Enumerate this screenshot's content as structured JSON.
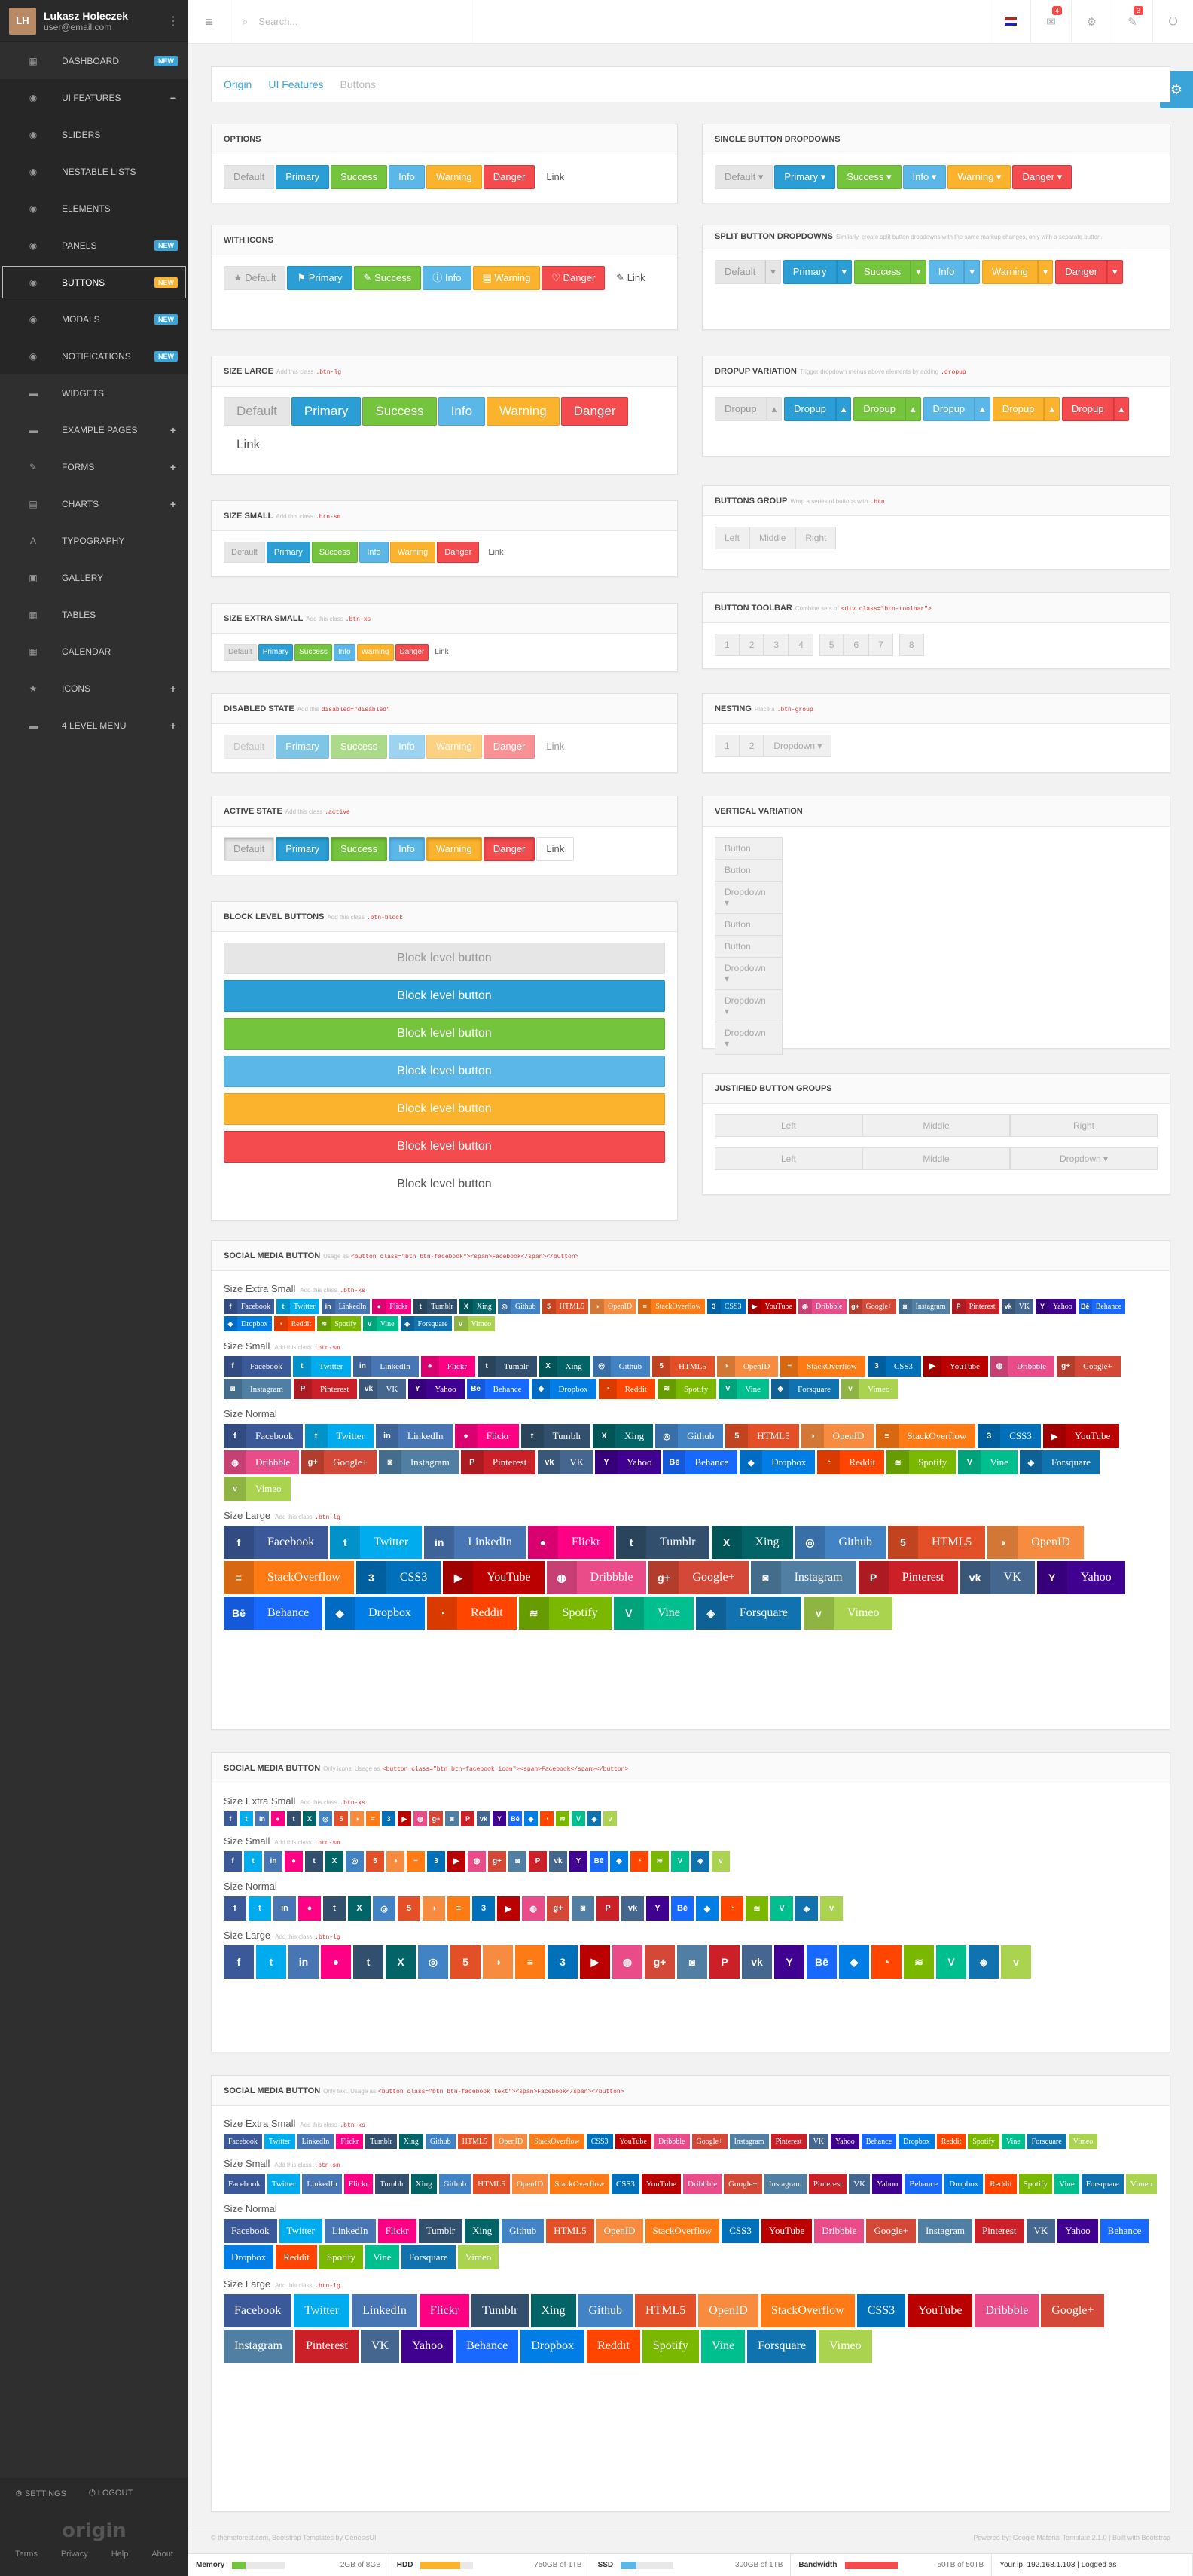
{
  "user": {
    "name": "Lukasz Holeczek",
    "email": "user@email.com",
    "initials": "LH"
  },
  "nav": [
    {
      "label": "Dashboard",
      "icon": "dashboard-icon",
      "glyph": "▦",
      "badge": "NEW",
      "badge_color": "#3aa3d7"
    },
    {
      "label": "UI Features",
      "icon": "eye-icon",
      "glyph": "◉",
      "open": true
    },
    {
      "label": "Sliders",
      "icon": "eye-icon",
      "glyph": "◉",
      "sub": true
    },
    {
      "label": "Nestable Lists",
      "icon": "eye-icon",
      "glyph": "◉",
      "sub": true
    },
    {
      "label": "Elements",
      "icon": "eye-icon",
      "glyph": "◉",
      "sub": true
    },
    {
      "label": "Panels",
      "icon": "eye-icon",
      "glyph": "◉",
      "sub": true,
      "badge": "NEW",
      "badge_color": "#3aa3d7"
    },
    {
      "label": "Buttons",
      "icon": "eye-icon",
      "glyph": "◉",
      "sub": true,
      "active": true,
      "badge": "NEW",
      "badge_color": "#fbb32e"
    },
    {
      "label": "Modals",
      "icon": "eye-icon",
      "glyph": "◉",
      "sub": true,
      "badge": "NEW",
      "badge_color": "#3aa3d7"
    },
    {
      "label": "Notifications",
      "icon": "eye-icon",
      "glyph": "◉",
      "sub": true,
      "badge": "NEW",
      "badge_color": "#3aa3d7"
    },
    {
      "label": "Widgets",
      "icon": "folder-icon",
      "glyph": "▬"
    },
    {
      "label": "Example Pages",
      "icon": "folder-icon",
      "glyph": "▬",
      "plus": true
    },
    {
      "label": "Forms",
      "icon": "edit-icon",
      "glyph": "✎",
      "plus": true
    },
    {
      "label": "Charts",
      "icon": "chart-icon",
      "glyph": "▤",
      "plus": true
    },
    {
      "label": "Typography",
      "icon": "font-icon",
      "glyph": "A"
    },
    {
      "label": "Gallery",
      "icon": "picture-icon",
      "glyph": "▣"
    },
    {
      "label": "Tables",
      "icon": "table-icon",
      "glyph": "▦"
    },
    {
      "label": "Calendar",
      "icon": "calendar-icon",
      "glyph": "▦"
    },
    {
      "label": "Icons",
      "icon": "star-icon",
      "glyph": "★",
      "plus": true
    },
    {
      "label": "4 Level Menu",
      "icon": "folder-icon",
      "glyph": "▬",
      "plus": true
    }
  ],
  "sidebar_bottom": {
    "settings": "Settings",
    "logout": "Logout",
    "logo": "origin",
    "links": [
      "Terms",
      "Privacy",
      "Help",
      "About"
    ]
  },
  "topbar": {
    "search_placeholder": "Search...",
    "notif_count": "4",
    "tools_count": "3"
  },
  "breadcrumb": [
    "Origin",
    "UI Features",
    "Buttons"
  ],
  "labels": {
    "default": "Default",
    "primary": "Primary",
    "success": "Success",
    "info": "Info",
    "warning": "Warning",
    "danger": "Danger",
    "link": "Link",
    "dropup": "Dropup",
    "block": "Block level button",
    "button": "Button",
    "dropdown": "Dropdown",
    "left": "Left",
    "middle": "Middle",
    "right": "Right"
  },
  "panels": {
    "options": "Options",
    "with_icons": "With Icons",
    "size_large": "Size Large",
    "size_small": "Size Small",
    "size_xs": "Size Extra Small",
    "disabled": "Disabled State",
    "active": "Active State",
    "block": "Block Level Buttons",
    "single_dd": "Single Button Dropdowns",
    "split_dd": "Split Button Dropdowns",
    "dropup": "Dropup Variation",
    "btn_group": "Buttons Group",
    "toolbar": "Button Toolbar",
    "nesting": "Nesting",
    "vertical": "Vertical Variation",
    "justified": "Justified Button Groups",
    "social": "Social Media Button"
  },
  "hints": {
    "size_large": "Add this class",
    "size_small": "Add this class",
    "size_xs": "Add this class",
    "disabled": "Add this",
    "active": "Add this class",
    "block": "Add this class",
    "split_dd": "Similarly, create split button dropdowns with the same markup changes, only with a separate button.",
    "dropup": "Trigger dropdown menus above elements by adding",
    "btn_group": "Wrap a series of buttons with",
    "toolbar": "Combine sets of",
    "nesting": "Place a",
    "social_1": "Usage as",
    "social_2": "Only icons. Usage as",
    "social_3": "Only text. Usage as",
    "add_class": "Add this class"
  },
  "codes": {
    "lg": ".btn-lg",
    "sm": ".btn-sm",
    "xs": ".btn-xs",
    "disabled": "disabled=\"disabled\"",
    "active": ".active",
    "block": ".btn-block",
    "dropup": ".dropup",
    "group": ".btn",
    "toolbar": "<div class=\"btn-toolbar\">",
    "nest": ".btn-group",
    "social_1": "<button class=\"btn btn-facebook\"><span>Facebook</span></button>",
    "social_2": "<button class=\"btn btn-facebook icon\"><span>Facebook</span></button>",
    "social_3": "<button class=\"btn btn-facebook text\"><span>Facebook</span></button>"
  },
  "toolbar_numbers": [
    "1",
    "2",
    "3",
    "4",
    "5",
    "6",
    "7",
    "8"
  ],
  "nesting_numbers": [
    "1",
    "2"
  ],
  "social_sizes": [
    "Size Extra Small",
    "Size Small",
    "Size Normal",
    "Size Large"
  ],
  "social_size_codes": [
    ".btn-xs",
    ".btn-sm",
    "",
    ".btn-lg"
  ],
  "social": [
    {
      "name": "Facebook",
      "color": "#3b5998",
      "glyph": "f"
    },
    {
      "name": "Twitter",
      "color": "#00aced",
      "glyph": "t"
    },
    {
      "name": "LinkedIn",
      "color": "#4875b4",
      "glyph": "in"
    },
    {
      "name": "Flickr",
      "color": "#ff0084",
      "glyph": "●"
    },
    {
      "name": "Tumblr",
      "color": "#32506d",
      "glyph": "t"
    },
    {
      "name": "Xing",
      "color": "#026466",
      "glyph": "X"
    },
    {
      "name": "Github",
      "color": "#4183c4",
      "glyph": "◎"
    },
    {
      "name": "HTML5",
      "color": "#e34f26",
      "glyph": "5"
    },
    {
      "name": "OpenID",
      "color": "#f78c40",
      "glyph": "◑"
    },
    {
      "name": "StackOverflow",
      "color": "#fe7a15",
      "glyph": "≡"
    },
    {
      "name": "CSS3",
      "color": "#0170ba",
      "glyph": "3"
    },
    {
      "name": "YouTube",
      "color": "#b00",
      "glyph": "▶"
    },
    {
      "name": "Dribbble",
      "color": "#ea4c89",
      "glyph": "◍"
    },
    {
      "name": "Google+",
      "color": "#d34836",
      "glyph": "g+"
    },
    {
      "name": "Instagram",
      "color": "#517fa4",
      "glyph": "◙"
    },
    {
      "name": "Pinterest",
      "color": "#cb2027",
      "glyph": "P"
    },
    {
      "name": "VK",
      "color": "#45668e",
      "glyph": "vk"
    },
    {
      "name": "Yahoo",
      "color": "#400191",
      "glyph": "Y"
    },
    {
      "name": "Behance",
      "color": "#1769ff",
      "glyph": "Bē"
    },
    {
      "name": "Dropbox",
      "color": "#007ee5",
      "glyph": "◆"
    },
    {
      "name": "Reddit",
      "color": "#ff4500",
      "glyph": "◔"
    },
    {
      "name": "Spotify",
      "color": "#7ab800",
      "glyph": "≋"
    },
    {
      "name": "Vine",
      "color": "#00bf8f",
      "glyph": "V"
    },
    {
      "name": "Forsquare",
      "color": "#1073af",
      "glyph": "◈"
    },
    {
      "name": "Vimeo",
      "color": "#aad450",
      "glyph": "v"
    }
  ],
  "footer": {
    "left": "© themeforest.com, Bootstrap Templates by GenesisUI",
    "right": "Powered by: Google Material Template 2.1.0 | Built with Bootstrap"
  },
  "status": [
    {
      "label": "Memory",
      "value": "2GB of 8GB",
      "percent": 25,
      "color": "#75c43d"
    },
    {
      "label": "HDD",
      "value": "750GB of 1TB",
      "percent": 75,
      "color": "#fbb32e"
    },
    {
      "label": "SSD",
      "value": "300GB of 1TB",
      "percent": 30,
      "color": "#5bb7e8"
    },
    {
      "label": "Bandwidth",
      "value": "50TB of 50TB",
      "percent": 100,
      "color": "#f44b4e"
    }
  ],
  "status_ip": "Your ip: 192.168.1.103 | Logged as"
}
